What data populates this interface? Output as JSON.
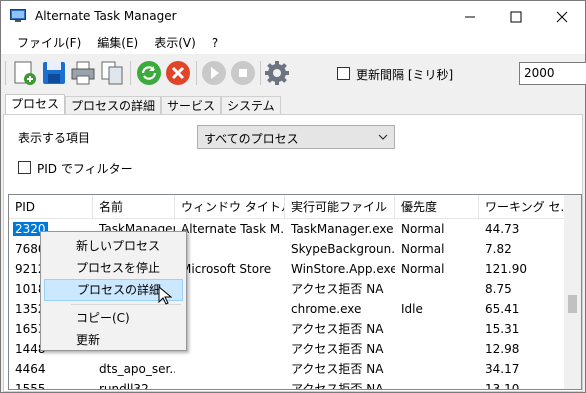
{
  "window": {
    "title": "Alternate Task Manager",
    "minimize_icon": "minimize-icon",
    "maximize_icon": "maximize-icon",
    "close_icon": "close-icon"
  },
  "menu": [
    "ファイル(F)",
    "編集(E)",
    "表示(V)",
    "?"
  ],
  "toolbar": {
    "buttons": [
      "new-process-icon",
      "save-icon",
      "print-icon",
      "copy-icon",
      "refresh-icon",
      "stop-process-icon",
      "play-icon",
      "pause-icon",
      "settings-gear-icon"
    ],
    "interval_label": "更新間隔 [ミリ秒]",
    "interval_value": "2000",
    "interval_checked": false
  },
  "tabs": [
    "プロセス",
    "プロセスの詳細",
    "サービス",
    "システム"
  ],
  "active_tab": 0,
  "filter": {
    "show_label": "表示する項目",
    "show_value": "すべてのプロセス",
    "pid_filter_label": "PID でフィルター",
    "pid_filter_checked": false
  },
  "table": {
    "columns": [
      "PID",
      "名前",
      "ウィンドウ タイトル",
      "実行可能ファイル",
      "優先度",
      "ワーキング セ..."
    ],
    "rows": [
      [
        "2320",
        "TaskManager",
        "Alternate Task M...",
        "TaskManager.exe",
        "Normal",
        "44.73"
      ],
      [
        "7680",
        "",
        "",
        "SkypeBackgroun...",
        "Normal",
        "7.82"
      ],
      [
        "9212",
        "",
        "Microsoft Store",
        "WinStore.App.exe",
        "Normal",
        "121.90"
      ],
      [
        "1018",
        "",
        "",
        "アクセス拒否 NA",
        "",
        "8.75"
      ],
      [
        "1352",
        "",
        "",
        "chrome.exe",
        "Idle",
        "65.41"
      ],
      [
        "1653",
        "",
        "",
        "アクセス拒否 NA",
        "",
        "15.31"
      ],
      [
        "1448",
        "",
        "",
        "アクセス拒否 NA",
        "",
        "12.98"
      ],
      [
        "4464",
        "dts_apo_ser...",
        "",
        "アクセス拒否 NA",
        "",
        "34.17"
      ],
      [
        "1555",
        "rundll32",
        "",
        "アクセス拒否 NA",
        "",
        "13.10"
      ]
    ],
    "selected_row": 0
  },
  "context_menu": {
    "items": [
      "新しいプロセス",
      "プロセスを停止",
      "プロセスの詳細",
      "コピー(C)",
      "更新"
    ],
    "hover_index": 2
  },
  "colors": {
    "selection": "#0078d7",
    "menu_hover": "#cce8ff",
    "window_bg": "#f0f0f0"
  }
}
